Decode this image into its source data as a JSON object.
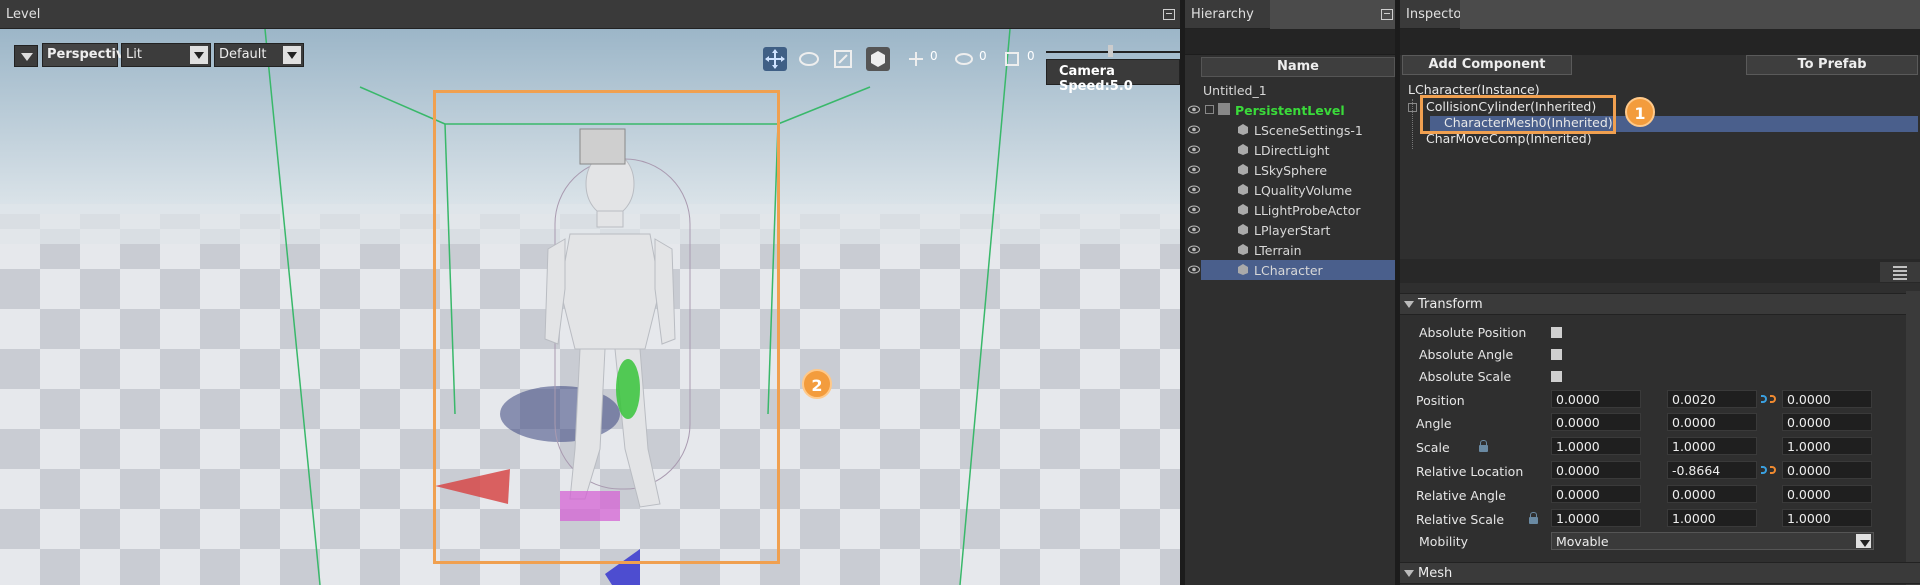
{
  "level_panel": {
    "title": "Level"
  },
  "viewport": {
    "view_mode": "Perspective",
    "lighting": "Lit",
    "preset": "Default",
    "snap_move": "0",
    "snap_rotate": "0",
    "snap_scale": "0",
    "camera_speed": "Camera Speed:5.0",
    "callout": "2"
  },
  "hierarchy": {
    "title": "Hierarchy",
    "column_name": "Name",
    "root": "Untitled_1",
    "level": "PersistentLevel",
    "items": [
      {
        "label": "LSceneSettings-1"
      },
      {
        "label": "LDirectLight"
      },
      {
        "label": "LSkySphere"
      },
      {
        "label": "LQualityVolume"
      },
      {
        "label": "LLightProbeActor"
      },
      {
        "label": "LPlayerStart"
      },
      {
        "label": "LTerrain"
      },
      {
        "label": "LCharacter"
      }
    ]
  },
  "inspector": {
    "title": "Inspector",
    "add_component": "Add Component",
    "to_prefab": "To Prefab",
    "instance": "LCharacter(Instance)",
    "components": [
      {
        "label": "CollisionCylinder(Inherited)"
      },
      {
        "label": "CharacterMesh0(Inherited)"
      },
      {
        "label": "CharMoveComp(Inherited)"
      }
    ],
    "callout": "1",
    "transform_title": "Transform",
    "absolute_position": "Absolute Position",
    "absolute_angle": "Absolute Angle",
    "absolute_scale": "Absolute Scale",
    "rows": [
      {
        "label": "Position",
        "x": "0.0000",
        "y": "0.0020",
        "z": "0.0000"
      },
      {
        "label": "Angle",
        "x": "0.0000",
        "y": "0.0000",
        "z": "0.0000"
      },
      {
        "label": "Scale",
        "x": "1.0000",
        "y": "1.0000",
        "z": "1.0000"
      },
      {
        "label": "Relative Location",
        "x": "0.0000",
        "y": "-0.8664",
        "z": "0.0000"
      },
      {
        "label": "Relative Angle",
        "x": "0.0000",
        "y": "0.0000",
        "z": "0.0000"
      },
      {
        "label": "Relative Scale",
        "x": "1.0000",
        "y": "1.0000",
        "z": "1.0000"
      }
    ],
    "mobility_label": "Mobility",
    "mobility_value": "Movable",
    "mesh_title": "Mesh"
  },
  "colors": {
    "accent_orange": "#f0a050",
    "selection": "#4a5f8c",
    "level_green": "#3adb3a"
  }
}
